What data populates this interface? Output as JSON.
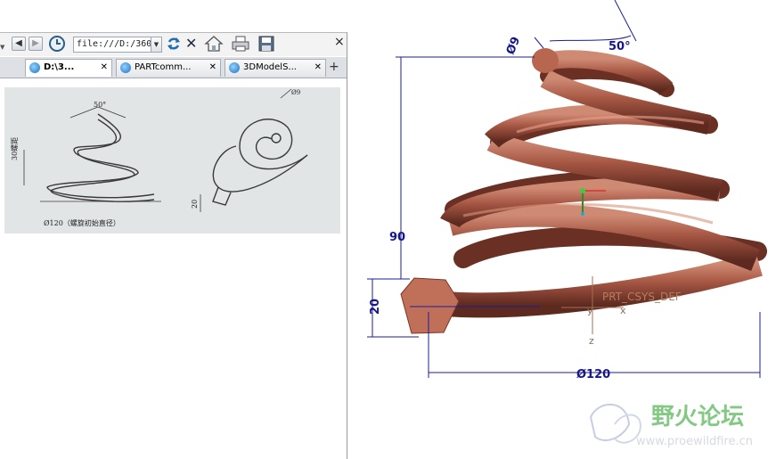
{
  "browser": {
    "address": "file:///D:/360",
    "tabs": [
      {
        "label": "D:\\3...",
        "active": true
      },
      {
        "label": "PARTcomm...",
        "active": false
      },
      {
        "label": "3DModelS...",
        "active": false
      }
    ]
  },
  "drawing_labels": {
    "angle": "50°",
    "pitch": "30螺距",
    "base_diameter": "Ø120（螺旋初始直径）",
    "wire": "20",
    "wire_diameter": "Ø9"
  },
  "cad": {
    "dim_wire_diameter": "Ø9",
    "dim_angle": "50°",
    "dim_height": "90",
    "dim_wire": "20",
    "dim_base_diameter": "Ø120",
    "csys_label": "PRT_CSYS_DEF",
    "axis_y": "y",
    "axis_x": "x",
    "axis_z": "z"
  },
  "watermark": {
    "title": "野火论坛",
    "url": "www.proewildfire.cn"
  },
  "colors": {
    "spring": "#a85a46",
    "dimension": "#17178a",
    "watermark": "#6ec06e"
  }
}
